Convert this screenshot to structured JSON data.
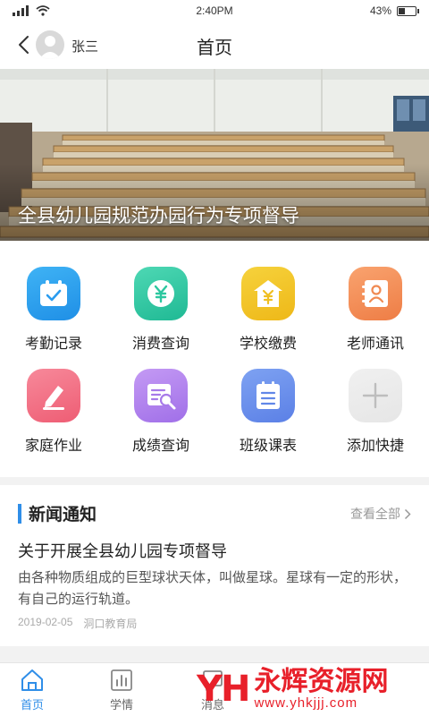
{
  "status_bar": {
    "time": "2:40PM",
    "battery": "43%",
    "battery_level": 0.43
  },
  "nav": {
    "user_name": "张三",
    "title": "首页"
  },
  "banner": {
    "caption": "全县幼儿园规范办园行为专项督导"
  },
  "grid": [
    {
      "label": "考勤记录",
      "icon": "calendar-check-icon",
      "color_a": "#3fb3f5",
      "color_b": "#1f8fe6"
    },
    {
      "label": "消费查询",
      "icon": "yuan-coin-icon",
      "color_a": "#4ed8b4",
      "color_b": "#1fb994"
    },
    {
      "label": "学校缴费",
      "icon": "school-fee-icon",
      "color_a": "#f6d23c",
      "color_b": "#eeb818"
    },
    {
      "label": "老师通讯",
      "icon": "contact-book-icon",
      "color_a": "#f9a36f",
      "color_b": "#ee7d45"
    },
    {
      "label": "家庭作业",
      "icon": "pencil-icon",
      "color_a": "#f7899a",
      "color_b": "#ee5d74"
    },
    {
      "label": "成绩查询",
      "icon": "grade-search-icon",
      "color_a": "#c49af4",
      "color_b": "#a06fe8"
    },
    {
      "label": "班级课表",
      "icon": "schedule-list-icon",
      "color_a": "#7ea2f2",
      "color_b": "#5b80e6"
    },
    {
      "label": "添加快捷",
      "icon": "plus-icon",
      "color_a": "#f0f0f0",
      "color_b": "#e6e6e6"
    }
  ],
  "news": {
    "section_title": "新闻通知",
    "view_all": "查看全部",
    "article": {
      "title": "关于开展全县幼儿园专项督导",
      "summary": "由各种物质组成的巨型球状天体，叫做星球。星球有一定的形状，有自己的运行轨道。",
      "date": "2019-02-05",
      "source": "洞口教育局"
    }
  },
  "tabs": [
    {
      "label": "首页",
      "icon": "home-icon",
      "active": true
    },
    {
      "label": "学情",
      "icon": "bar-chart-icon",
      "active": false
    },
    {
      "label": "消息",
      "icon": "message-icon",
      "active": false
    },
    {
      "label": "",
      "icon": "",
      "active": false
    },
    {
      "label": "",
      "icon": "",
      "active": false
    }
  ],
  "watermark": {
    "logo": "YH",
    "main": "永辉资源网",
    "sub": "www.yhkjjj.com"
  },
  "colors": {
    "accent": "#2f8ee8",
    "watermark": "#e8202a"
  }
}
